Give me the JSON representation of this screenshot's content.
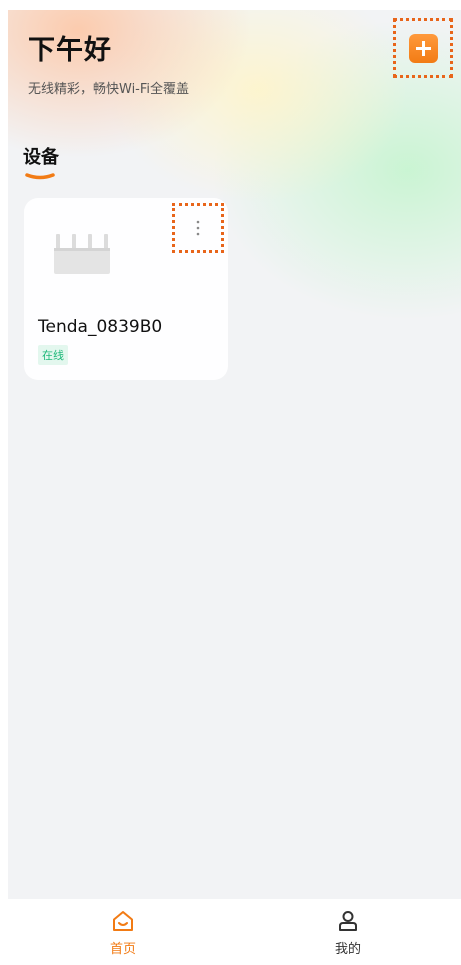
{
  "header": {
    "greeting": "下午好",
    "subtitle": "无线精彩，畅快Wi-Fi全覆盖",
    "add_icon": "plus-icon"
  },
  "devices_section": {
    "title": "设备"
  },
  "devices": [
    {
      "name": "Tenda_0839B0",
      "status": "在线",
      "image_icon": "router-icon",
      "menu_icon": "more-vertical-icon"
    }
  ],
  "bottom_nav": {
    "items": [
      {
        "label": "首页",
        "icon": "home-icon",
        "active": true
      },
      {
        "label": "我的",
        "icon": "user-icon",
        "active": false
      }
    ]
  },
  "colors": {
    "accent": "#f27b14",
    "highlight_frame": "#e8651a",
    "status_online": "#1fb97a",
    "background": "#f2f3f5"
  }
}
